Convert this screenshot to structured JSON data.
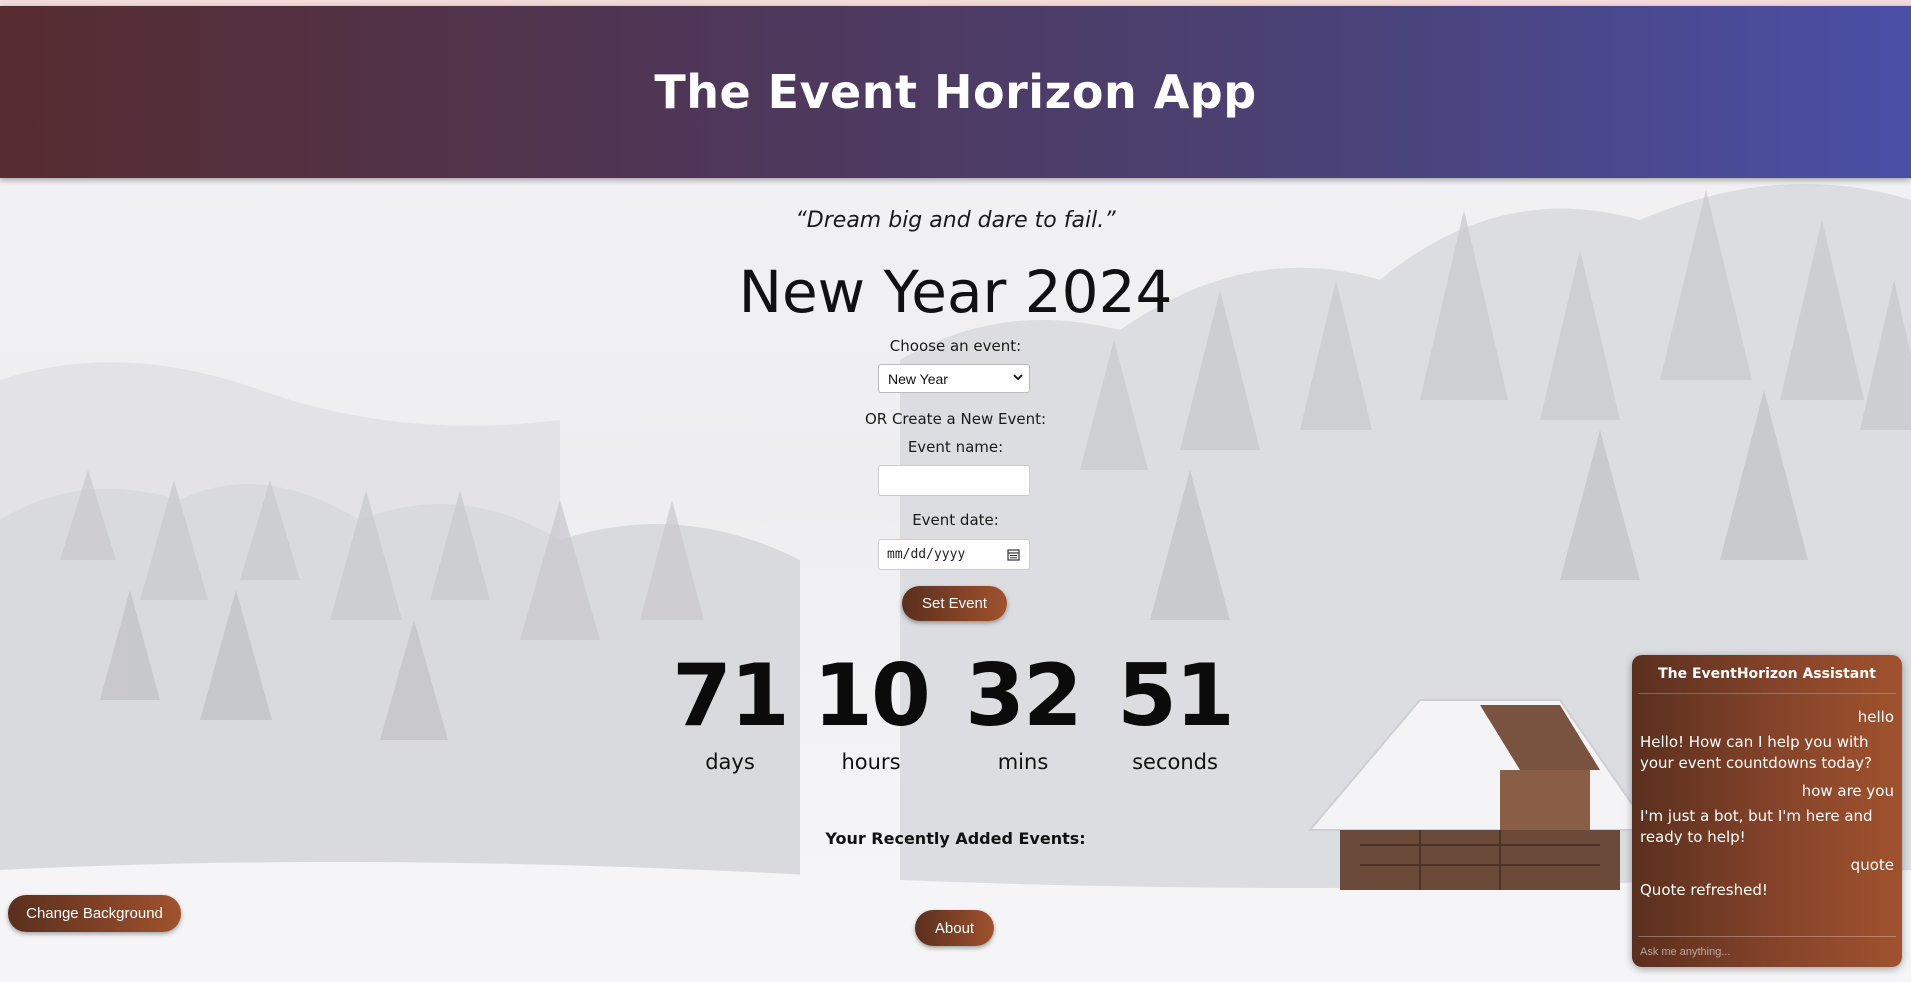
{
  "app": {
    "title": "The Event Horizon App"
  },
  "main": {
    "quote": "“Dream big and dare to fail.”",
    "event_title": "New Year 2024",
    "choose_label": "Choose an event:",
    "selected_event": "New Year",
    "or_label": "OR Create a New Event:",
    "event_name_label": "Event name:",
    "event_name_value": "",
    "event_date_label": "Event date:",
    "event_date_placeholder": "mm/dd/yyyy",
    "set_event_button": "Set Event",
    "recent_events_label": "Your Recently Added Events:",
    "about_button": "About",
    "change_background_button": "Change Background"
  },
  "countdown": {
    "days": "71",
    "days_label": "days",
    "hours": "10",
    "hours_label": "hours",
    "mins": "32",
    "mins_label": "mins",
    "seconds": "51",
    "seconds_label": "seconds"
  },
  "chat": {
    "title": "The EventHorizon Assistant",
    "messages": [
      {
        "from": "user",
        "text": "hello"
      },
      {
        "from": "bot",
        "text": "Hello! How can I help you with your event countdowns today?"
      },
      {
        "from": "user",
        "text": "how are you"
      },
      {
        "from": "bot",
        "text": "I'm just a bot, but I'm here and ready to help!"
      },
      {
        "from": "user",
        "text": "quote"
      },
      {
        "from": "bot",
        "text": "Quote refreshed!"
      }
    ],
    "input_placeholder": "Ask me anything..."
  },
  "colors": {
    "header_start": "#562c30",
    "header_end": "#4a4fa6",
    "button_start": "#5a2f1d",
    "button_end": "#a0522d"
  }
}
